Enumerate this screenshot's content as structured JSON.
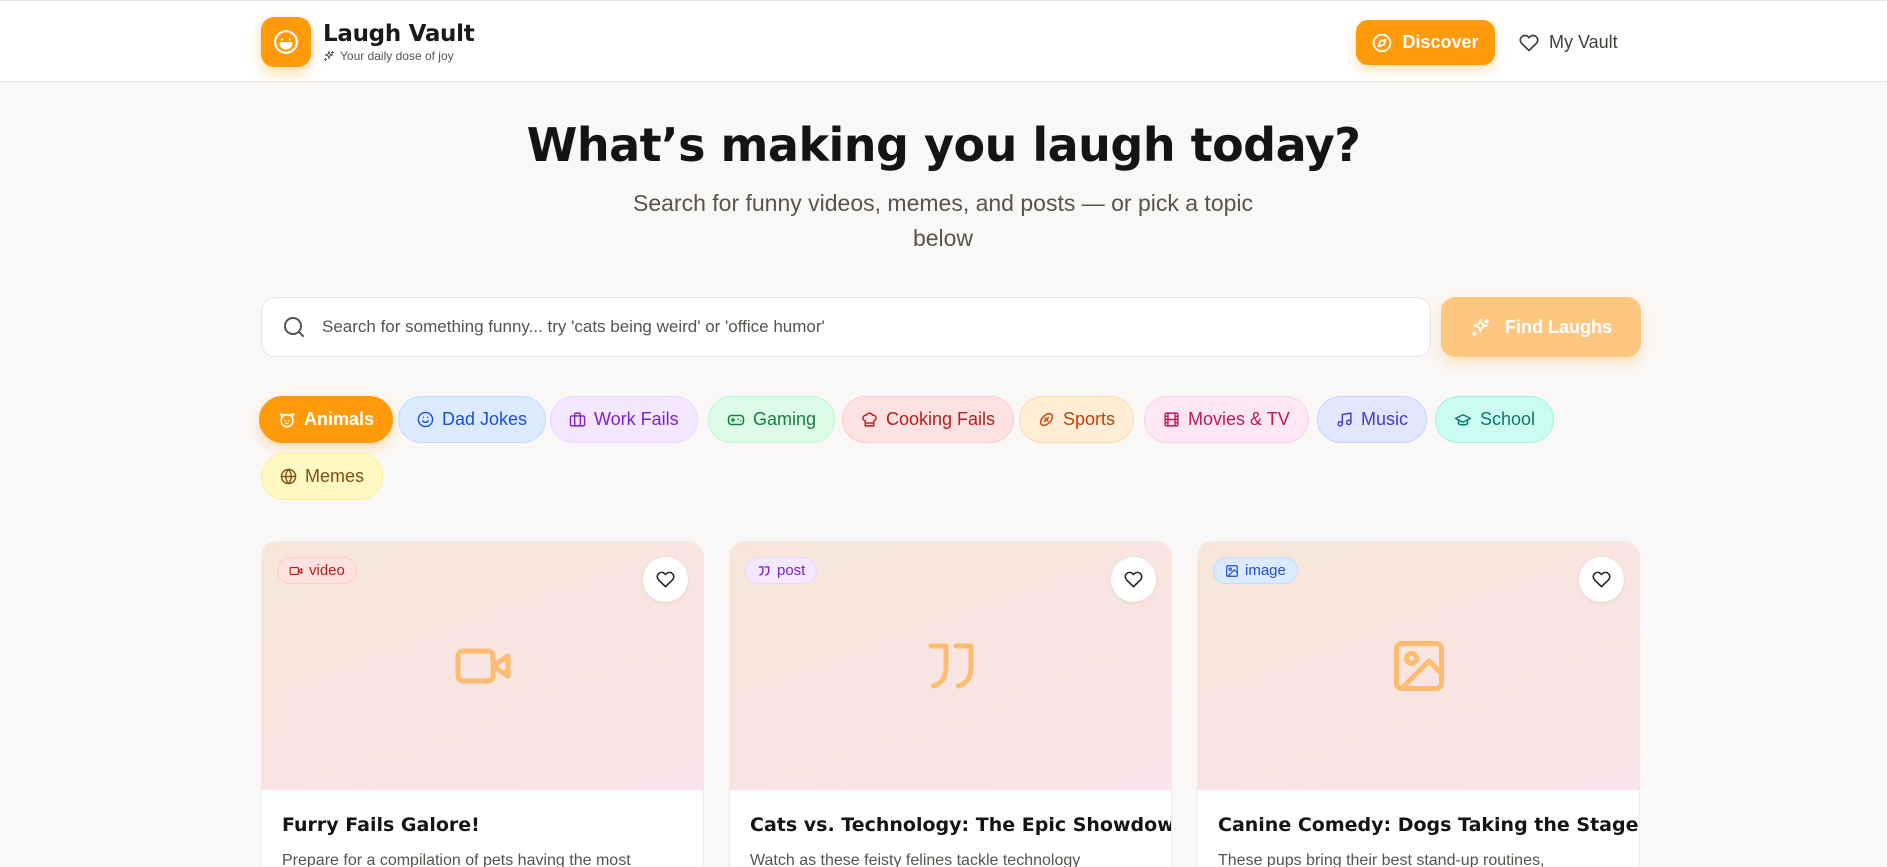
{
  "brand": {
    "title": "Laugh Vault",
    "subtitle": "Your daily dose of joy"
  },
  "nav": {
    "discover": "Discover",
    "vault": "My Vault"
  },
  "hero": {
    "title": "What’s making you laugh today?",
    "subtitle": "Search for funny videos, memes, and posts — or pick a topic below"
  },
  "search": {
    "placeholder": "Search for something funny... try 'cats being weird' or 'office humor'",
    "value": "",
    "button": "Find Laughs"
  },
  "topics": [
    {
      "label": "Animals",
      "icon": "paw-icon",
      "active": true
    },
    {
      "label": "Dad Jokes",
      "icon": "smile-icon"
    },
    {
      "label": "Work Fails",
      "icon": "briefcase-icon"
    },
    {
      "label": "Gaming",
      "icon": "gamepad-icon"
    },
    {
      "label": "Cooking Fails",
      "icon": "chef-hat-icon"
    },
    {
      "label": "Sports",
      "icon": "ball-icon"
    },
    {
      "label": "Movies & TV",
      "icon": "film-icon"
    },
    {
      "label": "Music",
      "icon": "music-icon"
    },
    {
      "label": "School",
      "icon": "graduation-cap-icon"
    },
    {
      "label": "Memes",
      "icon": "globe-icon"
    }
  ],
  "cards": [
    {
      "type": "video",
      "title": "Furry Fails Galore!",
      "description": "Prepare for a compilation of pets having the most"
    },
    {
      "type": "post",
      "title": "Cats vs. Technology: The Epic Showdown",
      "description": "Watch as these feisty felines tackle technology"
    },
    {
      "type": "image",
      "title": "Canine Comedy: Dogs Taking the Stage!",
      "description": "These pups bring their best stand-up routines,"
    }
  ],
  "colors": {
    "accent": "#ff9a0a",
    "accent_light": "#fdc782",
    "background": "#faf8f6"
  }
}
